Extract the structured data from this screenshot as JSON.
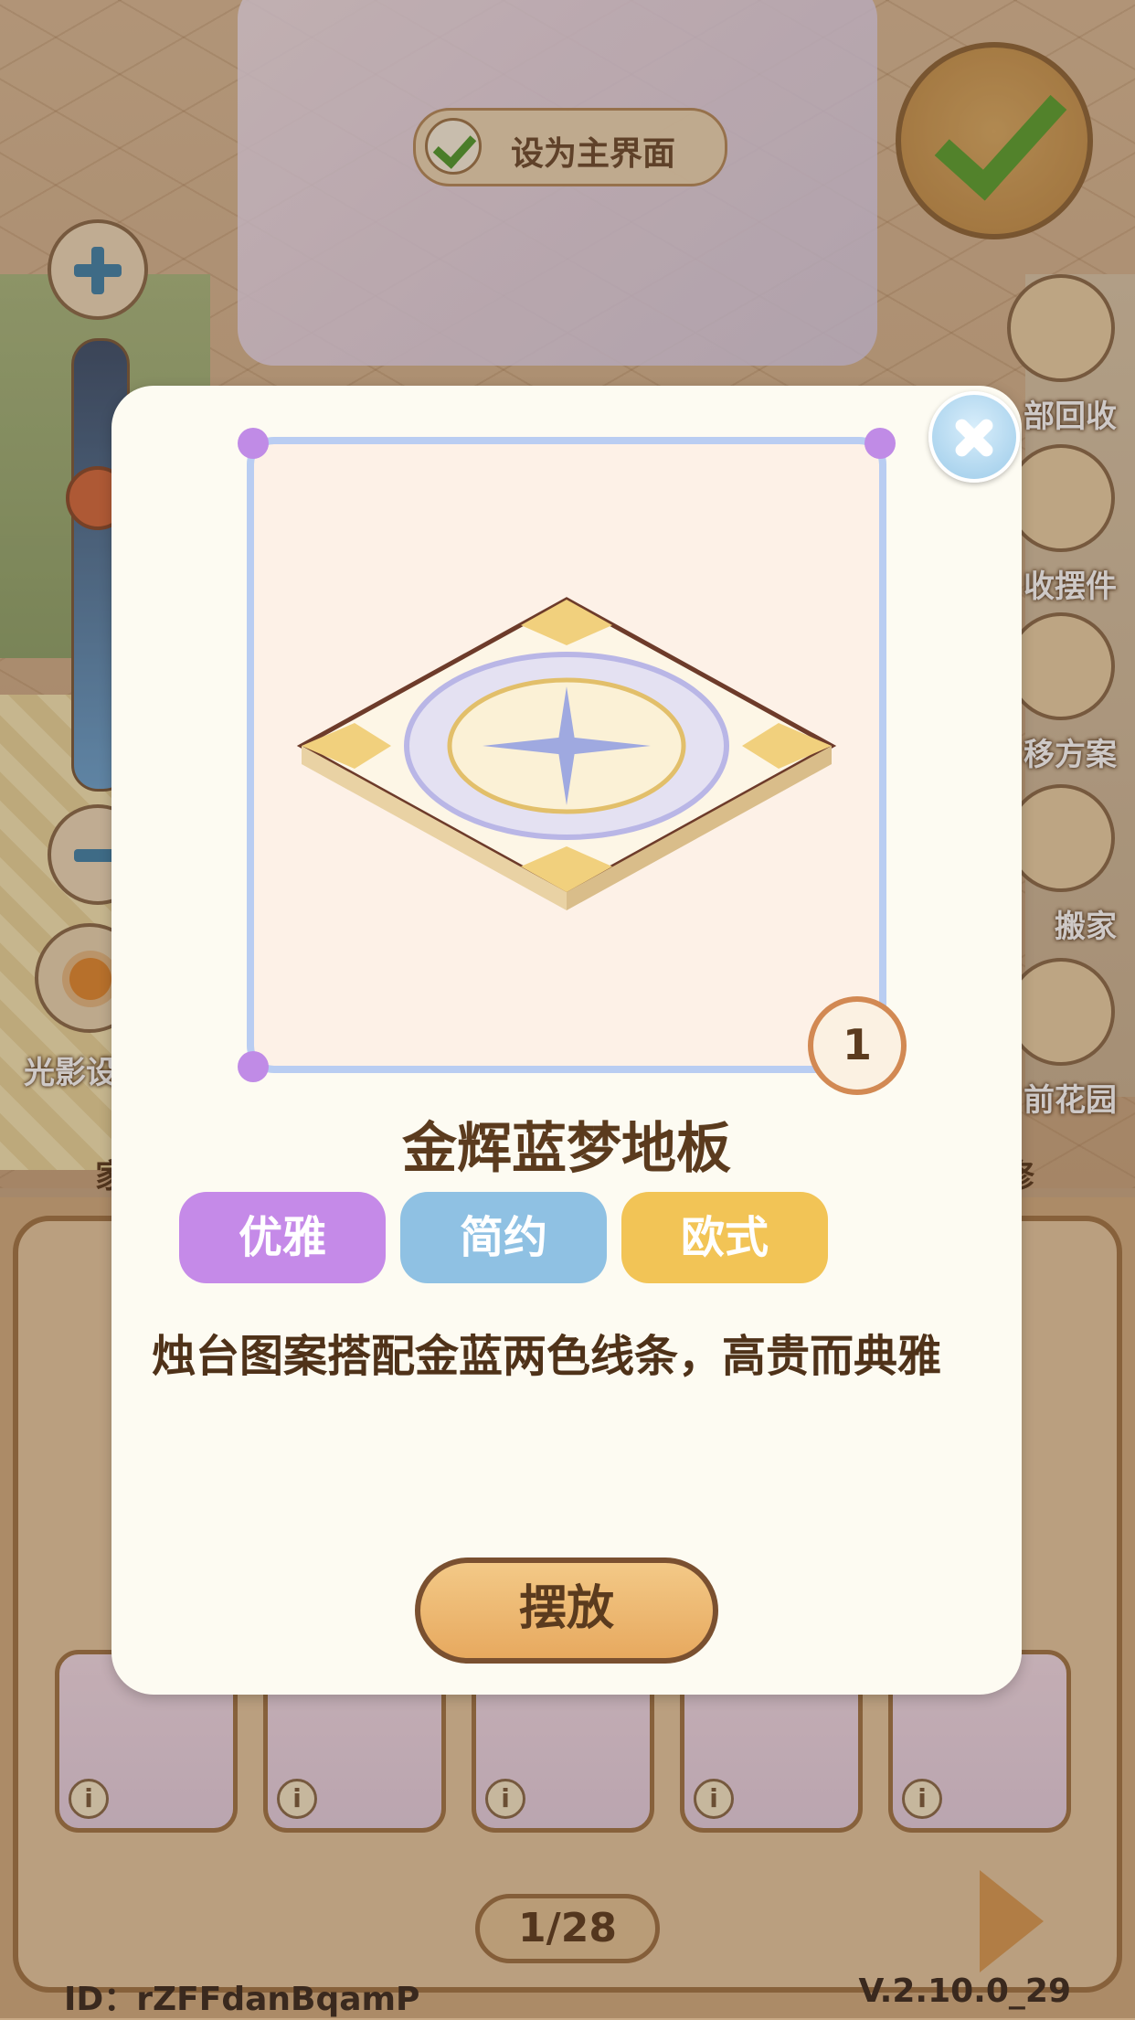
{
  "top": {
    "set_main_label": "设为主界面",
    "light_label": "光影设"
  },
  "right_menu": [
    {
      "label": "部回收",
      "icon": "recycle-box-icon"
    },
    {
      "label": "收摆件",
      "icon": "store-item-icon"
    },
    {
      "label": "移方案",
      "icon": "layout-plan-icon"
    },
    {
      "label": "搬家",
      "icon": "moving-truck-icon"
    },
    {
      "label": "前花园",
      "icon": "garden-arch-icon"
    }
  ],
  "modal": {
    "item_name": "金辉蓝梦地板",
    "count": "1",
    "tags": [
      {
        "label": "优雅",
        "color": "#c58ae8"
      },
      {
        "label": "简约",
        "color": "#8fc1e3"
      },
      {
        "label": "欧式",
        "color": "#f2c456"
      }
    ],
    "description": "烛台图案搭配金蓝两色线条，高贵而典雅",
    "place_button": "摆放"
  },
  "inventory": {
    "tab_left": "家",
    "tab_right": "修",
    "pager": "1/28"
  },
  "footer": {
    "id": "ID：rZFFdanBqamP",
    "version": "V.2.10.0_29"
  },
  "colors": {
    "accent_gold": "#e7a95f",
    "frame_blue": "#b9cdf2",
    "confirm_green": "#5aa02f"
  }
}
